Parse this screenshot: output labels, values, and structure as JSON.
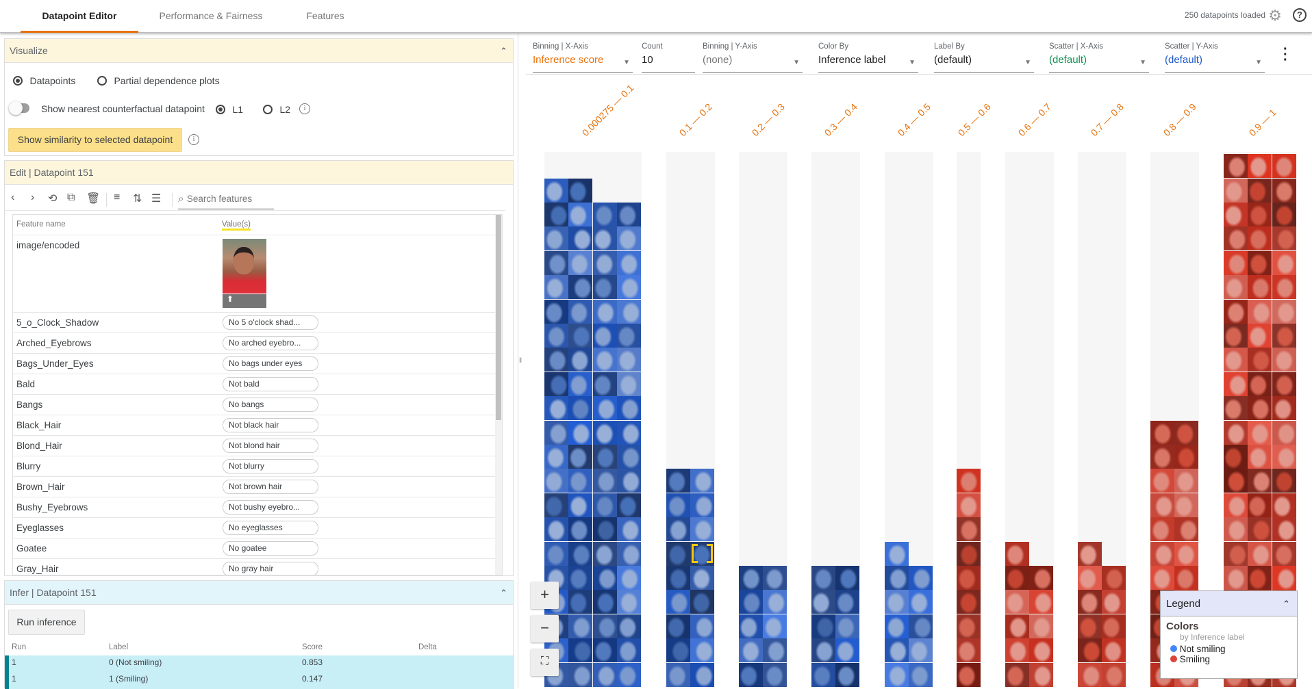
{
  "tabs": [
    {
      "label": "Datapoint Editor",
      "active": true
    },
    {
      "label": "Performance & Fairness"
    },
    {
      "label": "Features"
    }
  ],
  "status": "250 datapoints loaded",
  "visualize": {
    "title": "Visualize",
    "opt_datapoints": "Datapoints",
    "opt_pdp": "Partial dependence plots",
    "counterfactual": "Show nearest counterfactual datapoint",
    "l1": "L1",
    "l2": "L2",
    "similarity_button": "Show similarity to selected datapoint"
  },
  "edit": {
    "title": "Edit | Datapoint 151",
    "search_placeholder": "Search features",
    "col_name": "Feature name",
    "col_value": "Value(s)",
    "image_feature": "image/encoded",
    "features": [
      {
        "name": "5_o_Clock_Shadow",
        "value": "No 5 o'clock shad..."
      },
      {
        "name": "Arched_Eyebrows",
        "value": "No arched eyebro..."
      },
      {
        "name": "Bags_Under_Eyes",
        "value": "No bags under eyes"
      },
      {
        "name": "Bald",
        "value": "Not bald"
      },
      {
        "name": "Bangs",
        "value": "No bangs"
      },
      {
        "name": "Black_Hair",
        "value": "Not black hair"
      },
      {
        "name": "Blond_Hair",
        "value": "Not blond hair"
      },
      {
        "name": "Blurry",
        "value": "Not blurry"
      },
      {
        "name": "Brown_Hair",
        "value": "Not brown hair"
      },
      {
        "name": "Bushy_Eyebrows",
        "value": "Not bushy eyebro..."
      },
      {
        "name": "Eyeglasses",
        "value": "No eyeglasses"
      },
      {
        "name": "Goatee",
        "value": "No goatee"
      },
      {
        "name": "Gray_Hair",
        "value": "No gray hair"
      }
    ]
  },
  "infer": {
    "title": "Infer | Datapoint 151",
    "run_button": "Run inference",
    "cols": [
      "Run",
      "Label",
      "Score",
      "Delta"
    ],
    "rows": [
      {
        "run": "1",
        "label": "0 (Not smiling)",
        "score": "0.853",
        "delta": ""
      },
      {
        "run": "1",
        "label": "1 (Smiling)",
        "score": "0.147",
        "delta": ""
      }
    ]
  },
  "controls": [
    {
      "label": "Binning | X-Axis",
      "value": "Inference score",
      "color": "#e8710a"
    },
    {
      "label": "Count",
      "value": "10",
      "color": "#212121"
    },
    {
      "label": "Binning | Y-Axis",
      "value": "(none)",
      "color": "#757575"
    },
    {
      "label": "Color By",
      "value": "Inference label",
      "color": "#212121"
    },
    {
      "label": "Label By",
      "value": "(default)",
      "color": "#212121"
    },
    {
      "label": "Scatter | X-Axis",
      "value": "(default)",
      "color": "#0d904f"
    },
    {
      "label": "Scatter | Y-Axis",
      "value": "(default)",
      "color": "#1a57c7"
    }
  ],
  "chart_data": {
    "type": "bar",
    "categories": [
      "0.000275 — 0.1",
      "0.1 — 0.2",
      "0.2 — 0.3",
      "0.3 — 0.4",
      "0.4 — 0.5",
      "0.5 — 0.6",
      "0.6 — 0.7",
      "0.7 — 0.8",
      "0.8 — 0.9",
      "0.9 — 1"
    ],
    "values": [
      82,
      18,
      10,
      10,
      11,
      9,
      11,
      11,
      22,
      66
    ],
    "color_labels": [
      "Not smiling",
      "Not smiling",
      "Not smiling",
      "Not smiling",
      "Not smiling",
      "Smiling",
      "Smiling",
      "Smiling",
      "Smiling",
      "Smiling"
    ],
    "selected_bin": "0.1 — 0.2"
  },
  "legend": {
    "title": "Legend",
    "colors_title": "Colors",
    "colors_sub": "by Inference label",
    "items": [
      {
        "label": "Not smiling",
        "color": "#4285f4"
      },
      {
        "label": "Smiling",
        "color": "#db4437"
      }
    ]
  }
}
